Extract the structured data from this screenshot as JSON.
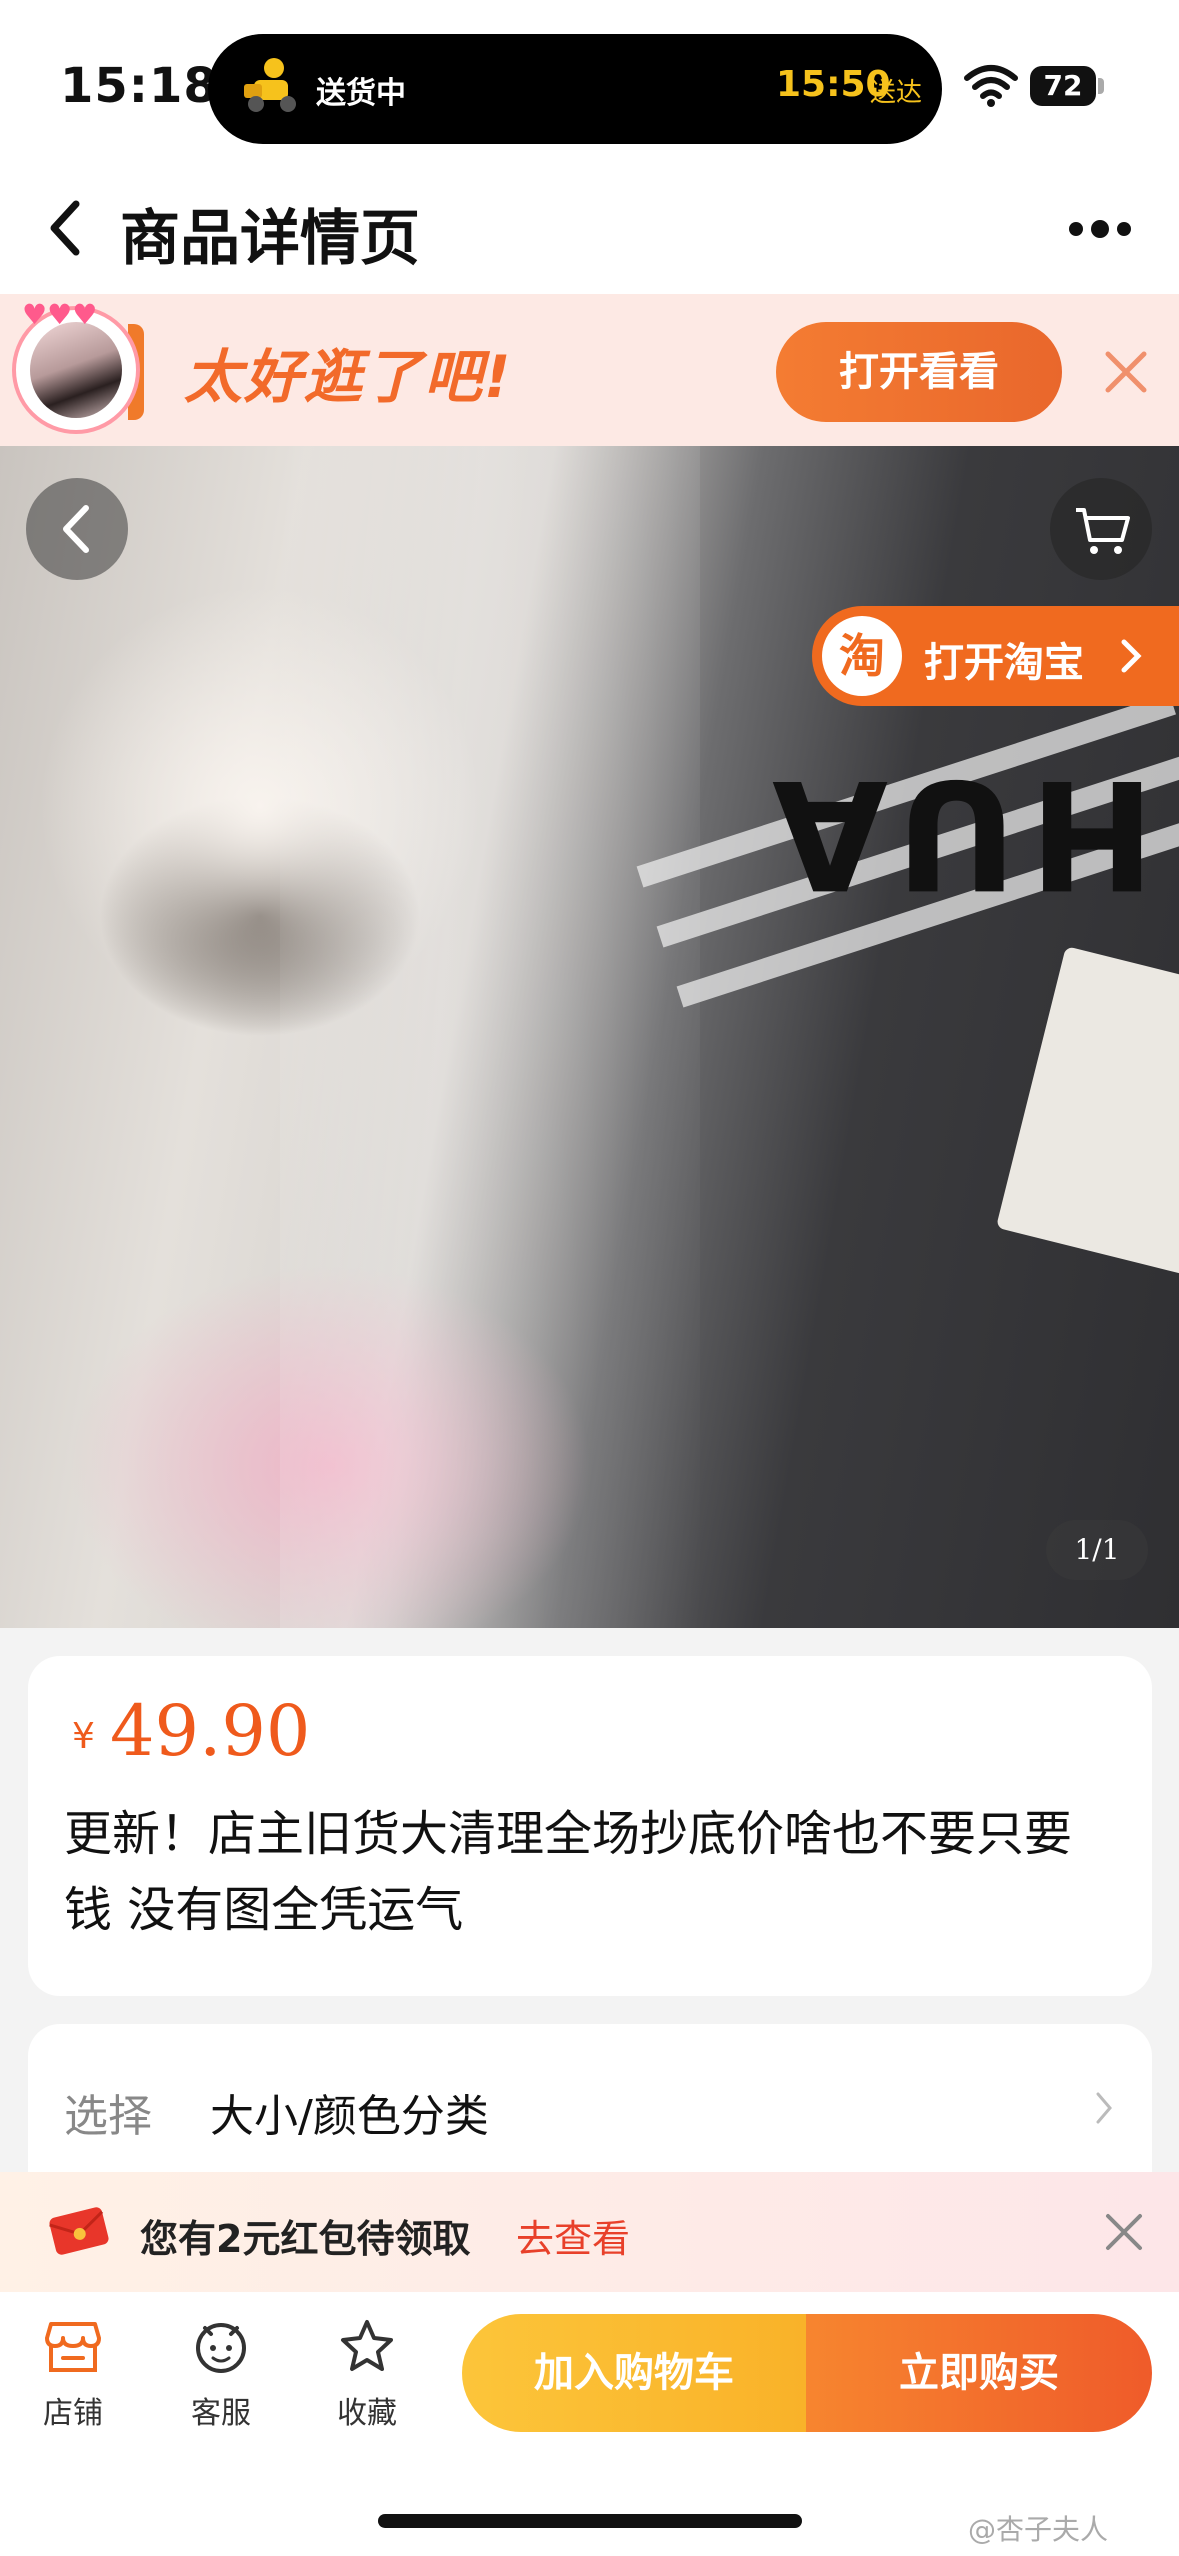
{
  "status_bar": {
    "time": "15:18",
    "live_activity": {
      "label": "送货中",
      "eta": "15:50",
      "eta_suffix": "送达"
    },
    "battery": "72"
  },
  "nav": {
    "title": "商品详情页"
  },
  "promo": {
    "text": "太好逛了吧!",
    "button": "打开看看",
    "hearts": "♥♥♥"
  },
  "gallery": {
    "open_app_button": "打开淘宝",
    "open_app_logo": "淘",
    "page_indicator": "1/1",
    "brand_print": "HUA"
  },
  "product": {
    "currency": "¥",
    "price": "49.90",
    "title": "更新！店主旧货大清理全场抄底价啥也不要只要钱 没有图全凭运气"
  },
  "sku": {
    "label": "选择",
    "value": "大小/颜色分类"
  },
  "coupon": {
    "text": "您有2元红包待领取",
    "link": "去查看"
  },
  "bottom_bar": {
    "tabs": [
      {
        "label": "店铺",
        "icon": "shop-icon"
      },
      {
        "label": "客服",
        "icon": "customer-service-icon"
      },
      {
        "label": "收藏",
        "icon": "star-icon"
      }
    ],
    "add_to_cart": "加入购物车",
    "buy_now": "立即购买"
  },
  "watermark": "@杏子夫人",
  "colors": {
    "accent": "#ef5a1c",
    "brand_orange": "#f06a1f",
    "cart_yellow": "#fcc53a"
  }
}
